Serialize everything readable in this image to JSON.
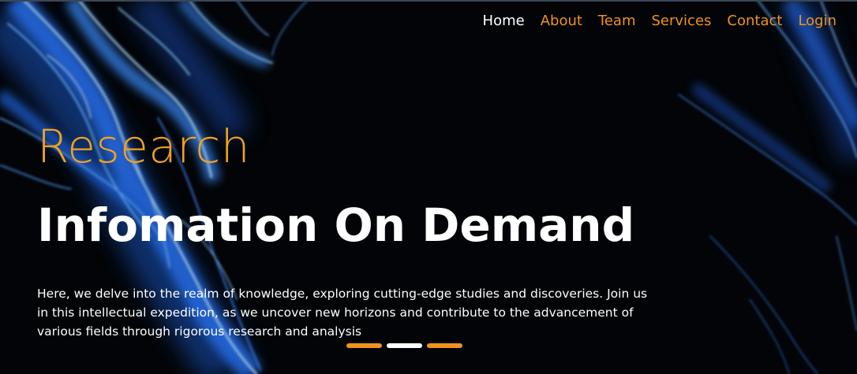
{
  "nav": {
    "items": [
      {
        "label": "Home",
        "active": true
      },
      {
        "label": "About",
        "active": false
      },
      {
        "label": "Team",
        "active": false
      },
      {
        "label": "Services",
        "active": false
      },
      {
        "label": "Contact",
        "active": false
      },
      {
        "label": "Login",
        "active": false
      }
    ]
  },
  "hero": {
    "kicker": "Research",
    "headline": "Infomation On Demand",
    "description": "Here, we delve into the realm of knowledge, exploring cutting-edge studies and discoveries. Join us in this intellectual expedition, as we uncover new horizons and contribute to the advancement of various fields through rigorous research and analysis"
  },
  "carousel": {
    "slide_count": 3,
    "active_index": 1
  },
  "colors": {
    "accent": "#f0921e",
    "kicker": "#f4a11d",
    "text": "#ffffff",
    "background": "#030508",
    "smoke": "#2f7dff"
  }
}
